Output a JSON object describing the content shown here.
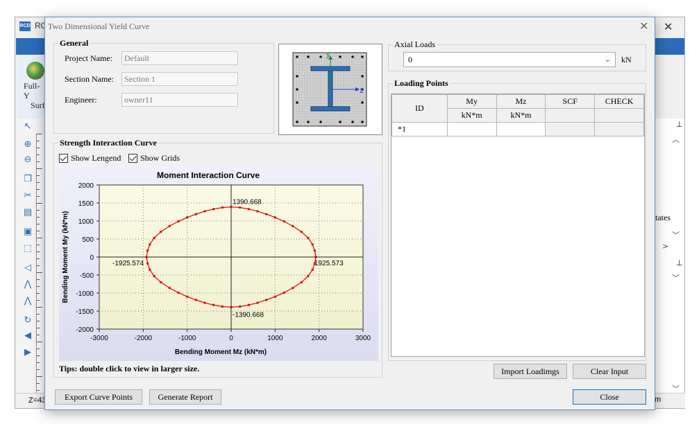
{
  "background_app": {
    "icon_text": "RCD",
    "title": "RC",
    "ribbon_label_1": "Full-Y",
    "ribbon_label_2": "Surf",
    "status_text": "Z=43",
    "status_right": "m",
    "right_panel_text": "tates"
  },
  "dialog": {
    "title": "Two Dimensional Yield Curve",
    "close_glyph": "✕"
  },
  "general": {
    "legend": "General",
    "project_name_label": "Project Name:",
    "project_name_value": "Default",
    "section_name_label": "Section Name:",
    "section_name_value": "Section 1",
    "engineer_label": "Engineer:",
    "engineer_value": "owner11"
  },
  "section_axes": {
    "y": "y",
    "z": "z"
  },
  "axial": {
    "legend": "Axial Loads",
    "value": "0",
    "unit": "kN"
  },
  "loading_points": {
    "legend": "Loading Points",
    "headers": [
      "ID",
      "My",
      "Mz",
      "SCF",
      "CHECK"
    ],
    "units": [
      "kN*m",
      "kN*m"
    ],
    "rows": [
      {
        "id": "1",
        "marker": "*",
        "my": "",
        "mz": "",
        "scf": "",
        "check": ""
      }
    ]
  },
  "strength": {
    "legend": "Strength Interaction Curve",
    "show_legend_label": "Show Lengend",
    "show_grids_label": "Show Grids",
    "tips": "Tips: double click to view in larger size."
  },
  "buttons": {
    "import": "Import Loadimgs",
    "clear": "Clear Input",
    "export": "Export Curve Points",
    "report": "Generate Report",
    "close": "Close"
  },
  "colors": {
    "curve": "#e00000",
    "plot_bg_top": "#fbfbe6",
    "plot_bg_bottom": "#f0f0d0",
    "chart_bg": "#e8e8f8",
    "accent": "#2b6cb9"
  },
  "chart_data": {
    "type": "scatter",
    "title": "Moment Interaction Curve",
    "xlabel": "Bending Moment Mz (kN*m)",
    "ylabel": "Bending Moment My (kN*m)",
    "xlim": [
      -3000,
      3000
    ],
    "ylim": [
      -2000,
      2000
    ],
    "x_ticks": [
      -3000,
      -2000,
      -1000,
      0,
      1000,
      2000,
      3000
    ],
    "y_ticks": [
      -2000,
      -1500,
      -1000,
      -500,
      0,
      500,
      1000,
      1500,
      2000
    ],
    "grid": true,
    "series": [
      {
        "x": [
          0,
          200,
          400,
          600,
          800,
          1000,
          1200,
          1400,
          1600,
          1750,
          1850,
          1900,
          1925.573,
          1900,
          1850,
          1750,
          1600,
          1400,
          1200,
          1000,
          800,
          600,
          400,
          200,
          0,
          -200,
          -400,
          -600,
          -800,
          -1000,
          -1200,
          -1400,
          -1600,
          -1750,
          -1850,
          -1900,
          -1925.574,
          -1900,
          -1850,
          -1750,
          -1600,
          -1400,
          -1200,
          -1000,
          -800,
          -600,
          -400,
          -200
        ],
        "y": [
          1390.668,
          1375,
          1330,
          1270,
          1190,
          1100,
          990,
          860,
          700,
          530,
          350,
          180,
          0,
          -180,
          -350,
          -530,
          -700,
          -860,
          -990,
          -1100,
          -1190,
          -1270,
          -1330,
          -1375,
          -1390.668,
          -1375,
          -1330,
          -1270,
          -1190,
          -1100,
          -990,
          -860,
          -700,
          -530,
          -350,
          -180,
          0,
          180,
          350,
          530,
          700,
          860,
          990,
          1100,
          1190,
          1270,
          1330,
          1375
        ]
      }
    ],
    "annotations": [
      {
        "text": "1390.668",
        "x": 0,
        "y": 1390.668
      },
      {
        "text": "-1390.668",
        "x": 0,
        "y": -1390.668
      },
      {
        "text": "1925.573",
        "x": 1925.573,
        "y": 0
      },
      {
        "text": "-1925.574",
        "x": -1925.574,
        "y": 0
      }
    ]
  }
}
